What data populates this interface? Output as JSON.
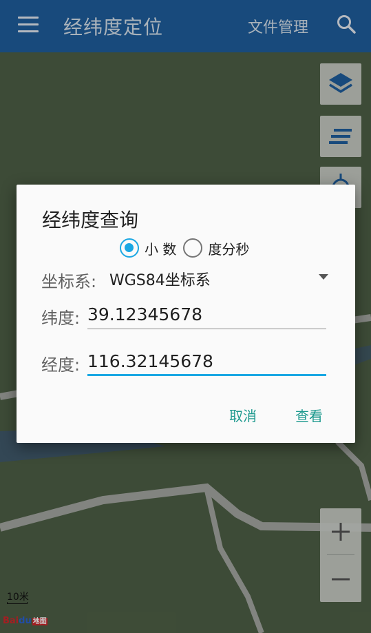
{
  "app_bar": {
    "title": "经纬度定位",
    "file_management": "文件管理",
    "menu_icon": "hamburger-menu-icon",
    "search_icon": "search-icon",
    "color": "#1f5f9f"
  },
  "map": {
    "scale_label": "10米",
    "logo_text": "Bai",
    "logo_paw": "du",
    "logo_map": "地图",
    "tools": [
      "layers-icon",
      "list-icon",
      "locate-icon"
    ],
    "zoom_in": "+",
    "zoom_out": "−"
  },
  "dialog": {
    "title": "经纬度查询",
    "format_options": [
      {
        "label": "小 数",
        "selected": true
      },
      {
        "label": "度分秒",
        "selected": false
      }
    ],
    "coord_system_label": "坐标系:",
    "coord_system_value": "WGS84坐标系",
    "latitude_label": "纬度:",
    "latitude_value": "39.12345678",
    "longitude_label": "经度:",
    "longitude_value": "116.32145678",
    "cancel_label": "取消",
    "view_label": "查看",
    "accent_color": "#1aa7e3",
    "button_color": "#1f9a8f"
  }
}
